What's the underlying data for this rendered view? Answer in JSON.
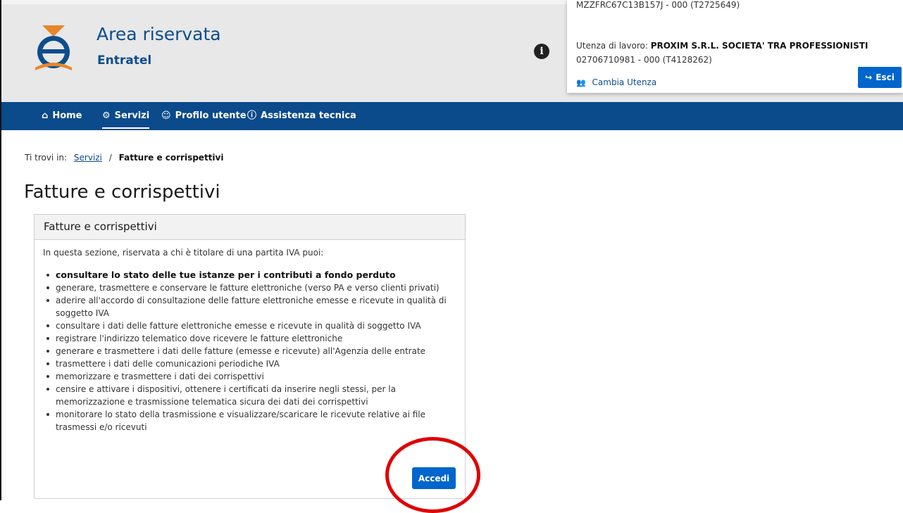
{
  "header": {
    "title": "Area riservata",
    "subtitle": "Entratel",
    "colors": {
      "brand_blue": "#0d4d8c",
      "nav_blue": "#0b4a8b",
      "button_blue": "#0066cc",
      "header_bg": "#e8e8e8"
    }
  },
  "user": {
    "codice_fiscale": "MZZFRC67C13B157J - 000 (T2725649)",
    "utenza_label": "Utenza di lavoro:",
    "utenza_name": "PROXIM S.R.L. SOCIETA' TRA PROFESSIONISTI",
    "partita_iva": "02706710981 - 000 (T4128262)",
    "cambia_utenza": "Cambia Utenza",
    "esci": "Esci"
  },
  "nav": {
    "items": [
      {
        "label": "Home",
        "icon": "home-icon"
      },
      {
        "label": "Servizi",
        "icon": "services-icon",
        "active": true
      },
      {
        "label": "Profilo utente",
        "icon": "user-icon"
      },
      {
        "label": "Assistenza tecnica",
        "icon": "info-icon"
      }
    ]
  },
  "breadcrumb": {
    "prefix": "Ti trovi in:",
    "link": "Servizi",
    "separator": "/",
    "current": "Fatture e corrispettivi"
  },
  "page": {
    "title": "Fatture e corrispettivi"
  },
  "panel": {
    "heading": "Fatture e corrispettivi",
    "intro": "In questa sezione, riservata a chi è titolare di una partita IVA puoi:",
    "items": [
      "consultare lo stato delle tue istanze per i contributi a fondo perduto",
      "generare, trasmettere e conservare le fatture elettroniche (verso PA e verso clienti privati)",
      "aderire all'accordo di consultazione delle fatture elettroniche emesse e ricevute in qualità di soggetto IVA",
      "consultare i dati delle fatture elettroniche emesse e ricevute in qualità di soggetto IVA",
      "registrare l'indirizzo telematico dove ricevere le fatture elettroniche",
      "generare e trasmettere i dati delle fatture (emesse e ricevute) all'Agenzia delle entrate",
      "trasmettere i dati delle comunicazioni periodiche IVA",
      "memorizzare e trasmettere i dati dei corrispettivi",
      "censire e attivare i dispositivi, ottenere i certificati da inserire negli stessi, per la memorizzazione e trasmissione telematica sicura dei dati dei corrispettivi",
      "monitorare lo stato della trasmissione e visualizzare/scaricare le ricevute relative ai file trasmessi e/o ricevuti"
    ],
    "button": "Accedi"
  }
}
